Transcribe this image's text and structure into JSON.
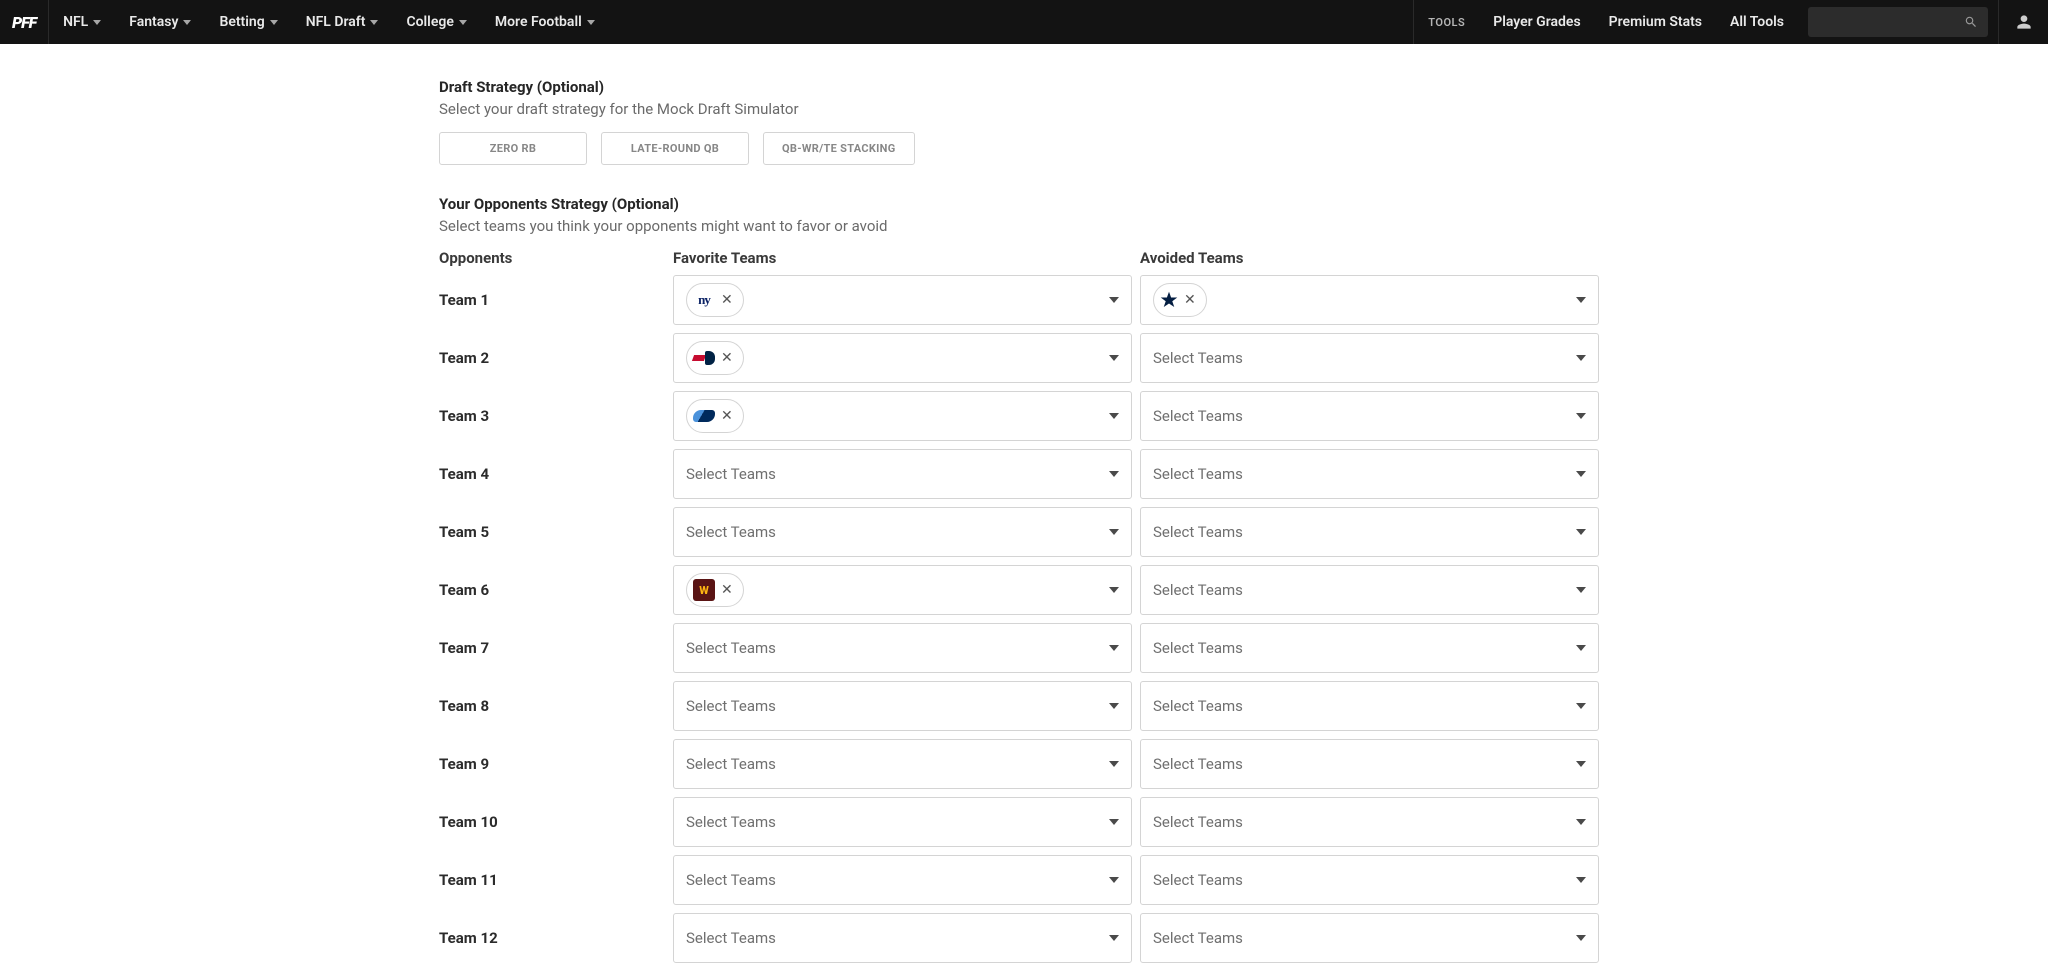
{
  "header": {
    "logo": "PFF",
    "nav": {
      "nfl": "NFL",
      "fantasy": "Fantasy",
      "betting": "Betting",
      "draft": "NFL Draft",
      "college": "College",
      "more": "More Football"
    },
    "tools_label": "TOOLS",
    "links": {
      "grades": "Player Grades",
      "stats": "Premium Stats",
      "all_tools": "All Tools"
    }
  },
  "strategy": {
    "title": "Draft Strategy (Optional)",
    "subtitle": "Select your draft strategy for the Mock Draft Simulator",
    "pills": {
      "zero_rb": "ZERO RB",
      "late_qb": "LATE-ROUND QB",
      "stacking": "QB-WR/TE STACKING"
    }
  },
  "opponents_section": {
    "title": "Your Opponents Strategy (Optional)",
    "subtitle": "Select teams you think your opponents might want to favor or avoid"
  },
  "columns": {
    "opponents": "Opponents",
    "favorite": "Favorite Teams",
    "avoided": "Avoided Teams"
  },
  "placeholder": "Select Teams",
  "teams": [
    {
      "label": "Team 1",
      "favorite_chips": [
        {
          "id": "nyg",
          "text": "ny"
        }
      ],
      "avoided_chips": [
        {
          "id": "dal",
          "text": "★"
        }
      ]
    },
    {
      "label": "Team 2",
      "favorite_chips": [
        {
          "id": "ne",
          "text": ""
        }
      ],
      "avoided_chips": []
    },
    {
      "label": "Team 3",
      "favorite_chips": [
        {
          "id": "ten",
          "text": ""
        }
      ],
      "avoided_chips": []
    },
    {
      "label": "Team 4",
      "favorite_chips": [],
      "avoided_chips": []
    },
    {
      "label": "Team 5",
      "favorite_chips": [],
      "avoided_chips": []
    },
    {
      "label": "Team 6",
      "favorite_chips": [
        {
          "id": "was",
          "text": "W"
        }
      ],
      "avoided_chips": []
    },
    {
      "label": "Team 7",
      "favorite_chips": [],
      "avoided_chips": []
    },
    {
      "label": "Team 8",
      "favorite_chips": [],
      "avoided_chips": []
    },
    {
      "label": "Team 9",
      "favorite_chips": [],
      "avoided_chips": []
    },
    {
      "label": "Team 10",
      "favorite_chips": [],
      "avoided_chips": []
    },
    {
      "label": "Team 11",
      "favorite_chips": [],
      "avoided_chips": []
    },
    {
      "label": "Team 12",
      "favorite_chips": [],
      "avoided_chips": []
    }
  ]
}
